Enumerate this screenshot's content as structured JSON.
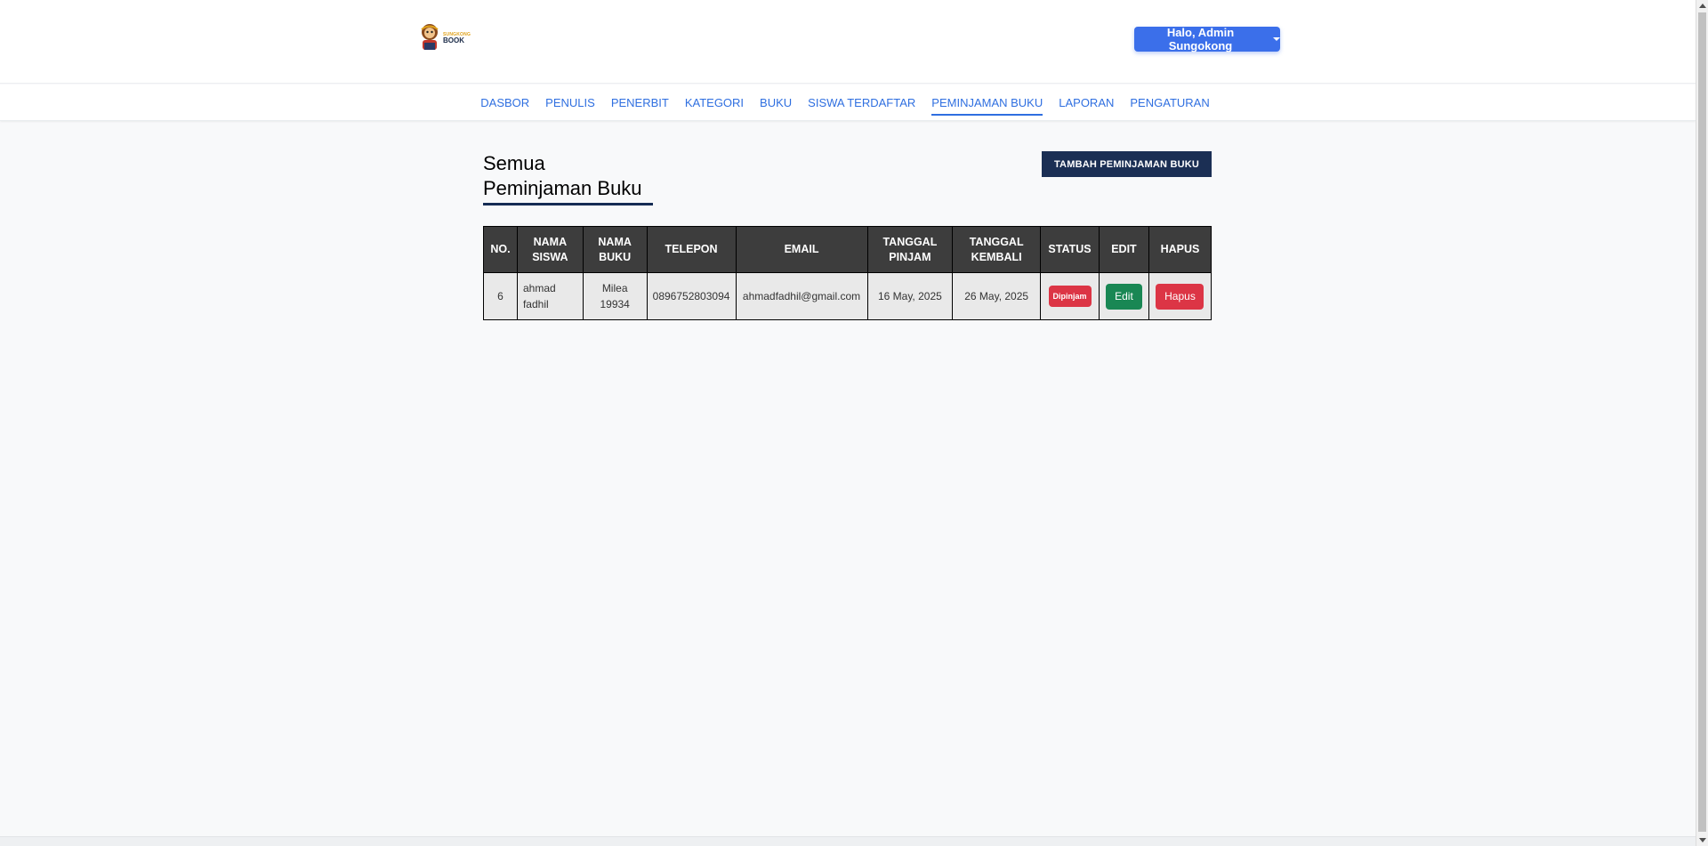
{
  "header": {
    "logo": {
      "line1": "SUNGKONG",
      "line2": "BOOK"
    },
    "user_menu_label": "Halo, Admin Sungokong"
  },
  "nav": {
    "items": [
      {
        "label": "DASBOR",
        "active": false
      },
      {
        "label": "PENULIS",
        "active": false
      },
      {
        "label": "PENERBIT",
        "active": false
      },
      {
        "label": "KATEGORI",
        "active": false
      },
      {
        "label": "BUKU",
        "active": false
      },
      {
        "label": "SISWA TERDAFTAR",
        "active": false
      },
      {
        "label": "PEMINJAMAN BUKU",
        "active": true
      },
      {
        "label": "LAPORAN",
        "active": false
      },
      {
        "label": "PENGATURAN",
        "active": false
      }
    ]
  },
  "main": {
    "title_line1": "Semua",
    "title_line2": "Peminjaman Buku",
    "add_button_label": "TAMBAH PEMINJAMAN BUKU",
    "table": {
      "columns": [
        {
          "line1": "NO.",
          "line2": ""
        },
        {
          "line1": "NAMA",
          "line2": "SISWA"
        },
        {
          "line1": "NAMA",
          "line2": "BUKU"
        },
        {
          "line1": "TELEPON",
          "line2": ""
        },
        {
          "line1": "EMAIL",
          "line2": ""
        },
        {
          "line1": "TANGGAL",
          "line2": "PINJAM"
        },
        {
          "line1": "TANGGAL",
          "line2": "KEMBALI"
        },
        {
          "line1": "STATUS",
          "line2": ""
        },
        {
          "line1": "EDIT",
          "line2": ""
        },
        {
          "line1": "HAPUS",
          "line2": ""
        }
      ],
      "rows": [
        {
          "no": "6",
          "student_line1": "ahmad",
          "student_line2": "fadhil",
          "book_line1": "Milea",
          "book_line2": "19934",
          "phone": "0896752803094",
          "email": "ahmadfadhil@gmail.com",
          "borrow_date": "16 May, 2025",
          "return_date": "26 May, 2025",
          "status": "Dipinjam",
          "edit_label": "Edit",
          "delete_label": "Hapus"
        }
      ]
    }
  },
  "colors": {
    "primary": "#3b6fea",
    "nav_link": "#2f6fe0",
    "dark_navy": "#1b2f54",
    "table_header": "#3d3d3d",
    "danger": "#dc3545",
    "success": "#198754"
  }
}
